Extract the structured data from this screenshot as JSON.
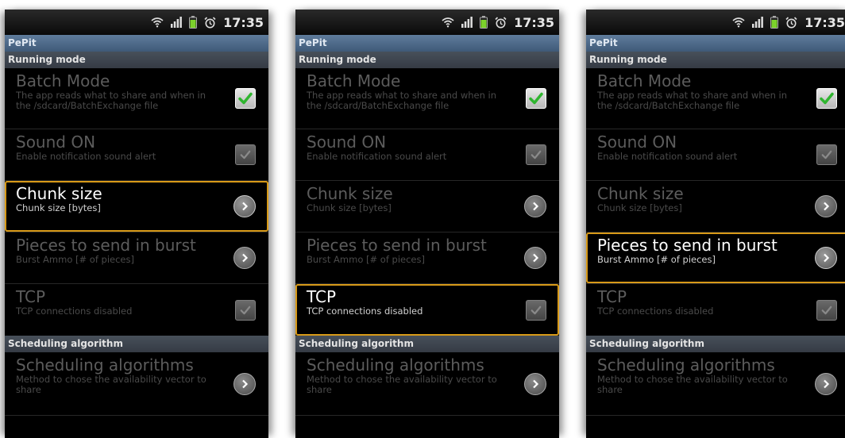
{
  "screens": [
    {
      "status": {
        "time": "17:35"
      },
      "title": "PePit",
      "categories": {
        "running": "Running mode",
        "scheduling": "Scheduling algorithm"
      },
      "prefs": {
        "batch": {
          "title": "Batch Mode",
          "summary": "The app reads what to share and when in the /sdcard/BatchExchange file",
          "checked": true
        },
        "sound": {
          "title": "Sound ON",
          "summary": "Enable notification sound alert",
          "checked": false
        },
        "chunk": {
          "title": "Chunk size",
          "summary": "Chunk size [bytes]"
        },
        "pieces": {
          "title": "Pieces to send in burst",
          "summary": "Burst Ammo [# of pieces]"
        },
        "tcp": {
          "title": "TCP",
          "summary": "TCP connections disabled",
          "checked": false
        },
        "sched": {
          "title": "Scheduling algorithms",
          "summary": "Method to chose the availability vector to share"
        }
      },
      "selected": "chunk"
    },
    {
      "status": {
        "time": "17:35"
      },
      "title": "PePit",
      "categories": {
        "running": "Running mode",
        "scheduling": "Scheduling algorithm"
      },
      "prefs": {
        "batch": {
          "title": "Batch Mode",
          "summary": "The app reads what to share and when in the /sdcard/BatchExchange file",
          "checked": true
        },
        "sound": {
          "title": "Sound ON",
          "summary": "Enable notification sound alert",
          "checked": false
        },
        "chunk": {
          "title": "Chunk size",
          "summary": "Chunk size [bytes]"
        },
        "pieces": {
          "title": "Pieces to send in burst",
          "summary": "Burst Ammo [# of pieces]"
        },
        "tcp": {
          "title": "TCP",
          "summary": "TCP connections disabled",
          "checked": false
        },
        "sched": {
          "title": "Scheduling algorithms",
          "summary": "Method to chose the availability vector to share"
        }
      },
      "selected": "tcp"
    },
    {
      "status": {
        "time": "17:35"
      },
      "title": "PePit",
      "categories": {
        "running": "Running mode",
        "scheduling": "Scheduling algorithm"
      },
      "prefs": {
        "batch": {
          "title": "Batch Mode",
          "summary": "The app reads what to share and when in the /sdcard/BatchExchange file",
          "checked": true
        },
        "sound": {
          "title": "Sound ON",
          "summary": "Enable notification sound alert",
          "checked": false
        },
        "chunk": {
          "title": "Chunk size",
          "summary": "Chunk size [bytes]"
        },
        "pieces": {
          "title": "Pieces to send in burst",
          "summary": "Burst Ammo [# of pieces]"
        },
        "tcp": {
          "title": "TCP",
          "summary": "TCP connections disabled",
          "checked": false
        },
        "sched": {
          "title": "Scheduling algorithms",
          "summary": "Method to chose the availability vector to share"
        }
      },
      "selected": "pieces"
    }
  ],
  "colors": {
    "highlight": "#d89a18",
    "checkmark": "#2fb52f",
    "titlebar": "#4f6b8a"
  },
  "icons": [
    "wifi-icon",
    "signal-icon",
    "battery-icon",
    "alarm-icon",
    "checkmark-icon",
    "chevron-right-icon"
  ]
}
